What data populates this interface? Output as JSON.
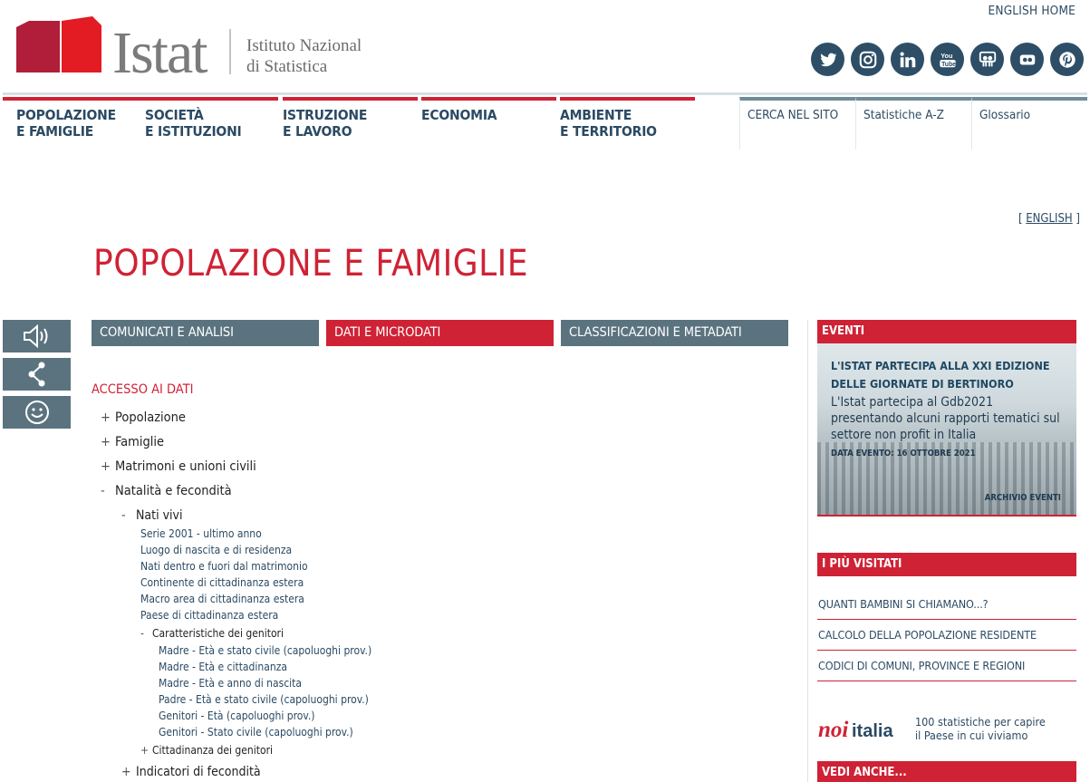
{
  "header": {
    "logo_word": "Istat",
    "logo_sub_1": "Istituto Nazionale",
    "logo_sub_2": "di Statistica",
    "english_home": "ENGLISH HOME",
    "social": [
      "twitter-icon",
      "instagram-icon",
      "linkedin-icon",
      "youtube-icon",
      "slideshare-icon",
      "flickr-icon",
      "pinterest-icon"
    ]
  },
  "nav": {
    "topics": [
      {
        "line1": "POPOLAZIONE",
        "line2": "E FAMIGLIE"
      },
      {
        "line1": "SOCIETÀ",
        "line2": "E ISTITUZIONI"
      },
      {
        "line1": "ISTRUZIONE",
        "line2": "E LAVORO"
      },
      {
        "line1": "ECONOMIA",
        "line2": ""
      },
      {
        "line1": "AMBIENTE",
        "line2": "E TERRITORIO"
      }
    ],
    "utils": [
      "CERCA NEL SITO",
      "Statistiche A-Z",
      "Glossario"
    ]
  },
  "page": {
    "english_link": "ENGLISH",
    "title": "POPOLAZIONE E FAMIGLIE"
  },
  "tabs": [
    "COMUNICATI E ANALISI",
    "DATI E MICRODATI",
    "CLASSIFICAZIONI E METADATI"
  ],
  "access": {
    "title": "ACCESSO AI DATI",
    "level1": [
      {
        "sign": "+",
        "label": "Popolazione"
      },
      {
        "sign": "+",
        "label": "Famiglie"
      },
      {
        "sign": "+",
        "label": "Matrimoni e unioni civili"
      },
      {
        "sign": "-",
        "label": "Natalità e fecondità"
      }
    ],
    "nati_vivi": {
      "sign": "-",
      "label": "Nati vivi"
    },
    "nati_items": [
      "Serie 2001 - ultimo anno",
      "Luogo di nascita e di residenza",
      "Nati dentro e fuori dal matrimonio",
      "Continente di cittadinanza estera",
      "Macro area di cittadinanza estera",
      "Paese di cittadinanza estera"
    ],
    "genitori": {
      "sign": "-",
      "label": "Caratteristiche dei genitori"
    },
    "genitori_items": [
      "Madre - Età e stato civile (capoluoghi prov.)",
      "Madre - Età e cittadinanza",
      "Madre - Età e anno di nascita",
      "Padre - Età e stato civile (capoluoghi prov.)",
      "Genitori - Età (capoluoghi prov.)",
      "Genitori - Stato civile (capoluoghi prov.)"
    ],
    "cittadinanza": {
      "sign": "+",
      "label": "Cittadinanza dei genitori"
    },
    "indicatori": {
      "sign": "+",
      "label": "Indicatori di fecondità"
    }
  },
  "sidebar": {
    "events_head": "EVENTI",
    "event_title": "L'ISTAT PARTECIPA ALLA XXI EDIZIONE DELLE GIORNATE DI BERTINORO",
    "event_desc": "L'Istat partecipa al Gdb2021 presentando alcuni rapporti tematici sul settore non profit in Italia",
    "event_date": "DATA EVENTO: 16 OTTOBRE 2021",
    "event_archive": "ARCHIVIO EVENTI",
    "visited_head": "I PIÙ VISITATI",
    "visited": [
      "QUANTI BAMBINI SI CHIAMANO...?",
      "CALCOLO DELLA POPOLAZIONE RESIDENTE",
      "CODICI DI COMUNI, PROVINCE E REGIONI"
    ],
    "noi_logo": "noi italia",
    "noi_line1": "100 statistiche per capire",
    "noi_line2": "il Paese in cui viviamo",
    "see_also_head": "VEDI ANCHE..."
  },
  "colors": {
    "red": "#cf2235",
    "slate": "#5a737f",
    "navy": "#2b4a63"
  }
}
